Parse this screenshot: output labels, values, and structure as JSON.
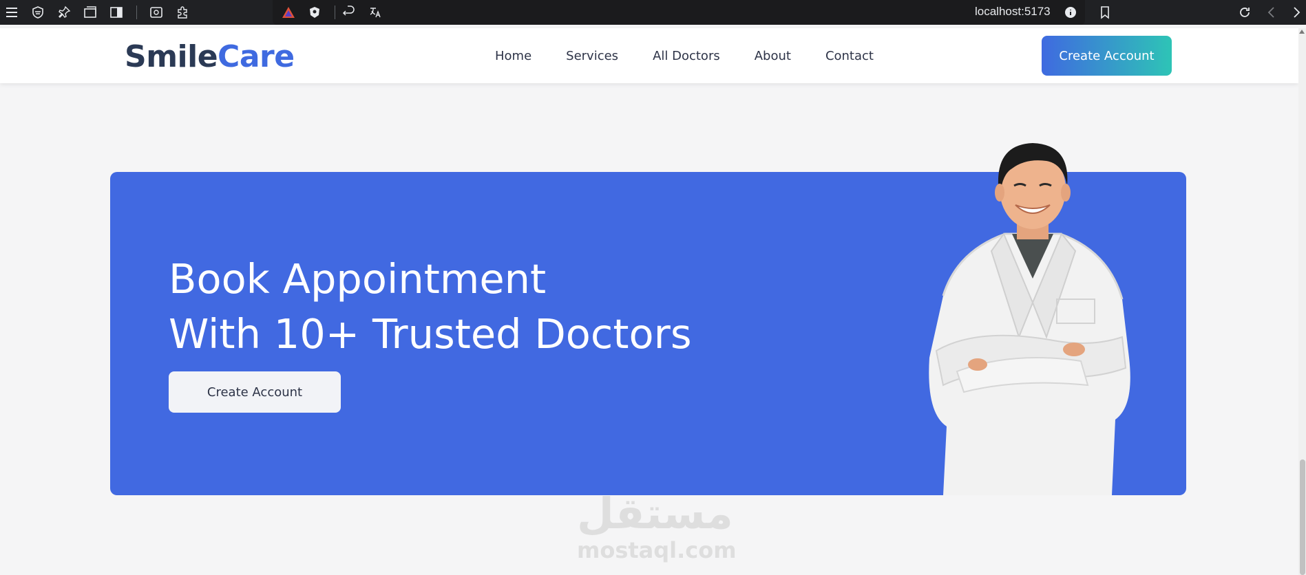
{
  "browser": {
    "url": "localhost:5173",
    "left_icons": [
      "menu-icon",
      "shield-icon",
      "pin-icon",
      "tabs-icon",
      "sidebar-icon",
      "screenshot-icon",
      "extensions-icon"
    ],
    "url_icons": [
      "brave-rewards-icon",
      "brave-shields-icon",
      "undo-icon",
      "translate-icon"
    ],
    "right_icons": [
      "info-icon",
      "bookmark-icon",
      "reload-icon",
      "back-icon",
      "forward-icon"
    ]
  },
  "nav": {
    "logo_part1": "Smile",
    "logo_part2": "Care",
    "links": [
      "Home",
      "Services",
      "All Doctors",
      "About",
      "Contact"
    ],
    "cta_label": "Create Account"
  },
  "hero": {
    "title_line1": "Book Appointment",
    "title_line2": "With 10+ Trusted Doctors",
    "button_label": "Create Account",
    "background": "#4169e1"
  },
  "colors": {
    "brand_dark": "#2b3a55",
    "brand_blue": "#3f6ae0",
    "gradient_end": "#2ec4b6"
  },
  "watermark": {
    "arabic": "مستقل",
    "latin": "mostaql.com"
  }
}
